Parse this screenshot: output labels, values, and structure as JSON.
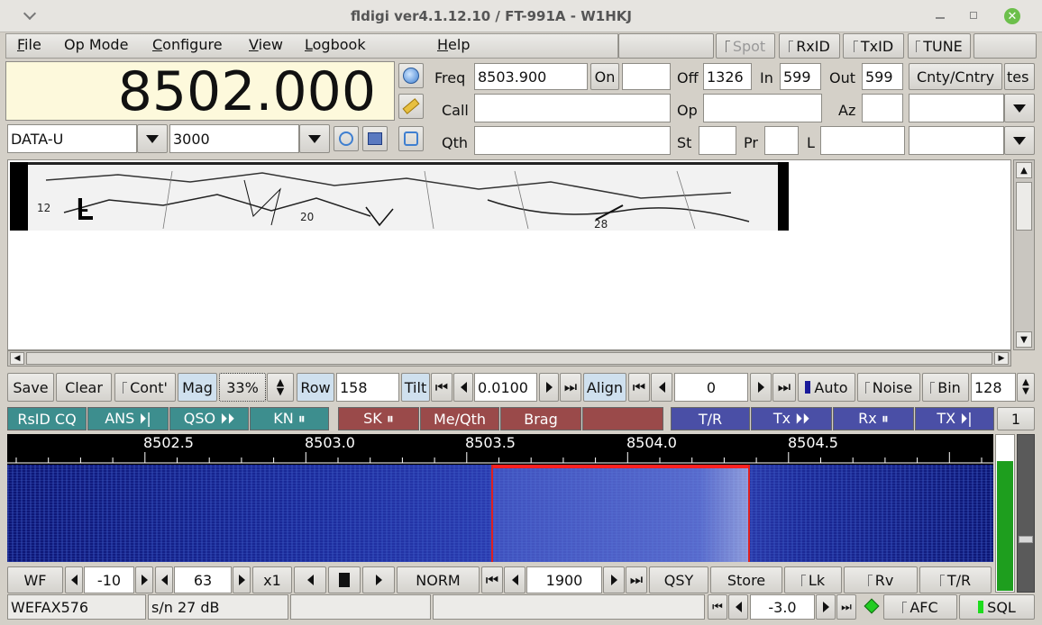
{
  "window": {
    "title": "fldigi ver4.1.12.10 / FT-991A - W1HKJ"
  },
  "menu": {
    "file": "File",
    "op_mode": "Op Mode",
    "configure": "Configure",
    "view": "View",
    "logbook": "Logbook",
    "help": "Help"
  },
  "top_toggles": {
    "spot": "Spot",
    "rxid": "RxID",
    "txid": "TxID",
    "tune": "TUNE"
  },
  "freq_display": {
    "value": "8502.000"
  },
  "rig": {
    "mode": "DATA-U",
    "bandwidth": "3000"
  },
  "log": {
    "freq_label": "Freq",
    "freq_value": "8503.900",
    "on_label": "On",
    "off_label": "Off",
    "off_value": "1326",
    "in_label": "In",
    "in_value": "599",
    "out_label": "Out",
    "out_value": "599",
    "cnty_label": "Cnty/Cntry",
    "tes_label": "tes",
    "call_label": "Call",
    "op_label": "Op",
    "az_label": "Az",
    "qth_label": "Qth",
    "st_label": "St",
    "pr_label": "Pr",
    "l_label": "L"
  },
  "fax_map": {
    "labels": [
      "12",
      "L",
      "20",
      "28"
    ]
  },
  "fax_controls": {
    "save": "Save",
    "clear": "Clear",
    "cont": "Cont'",
    "mag_label": "Mag",
    "mag_value": "33%",
    "row_label": "Row",
    "row_value": "158",
    "tilt_label": "Tilt",
    "tilt_value": "0.0100",
    "align_label": "Align",
    "align_value": "0",
    "auto": "Auto",
    "noise": "Noise",
    "bin": "Bin",
    "bin_value": "128"
  },
  "macros": {
    "b1": "RsID CQ",
    "b2": "ANS ⏵|",
    "b3": "QSO ⏵⏵",
    "b4": "KN ⏸",
    "b5": "SK ⏸",
    "b6": "Me/Qth",
    "b7": "Brag",
    "b8": "",
    "b9": "T/R",
    "b10": "Tx ⏵⏵",
    "b11": "Rx ⏸",
    "b12": "TX ⏵|",
    "bank": "1"
  },
  "scale": {
    "ticks": [
      "8502.5",
      "8503.0",
      "8503.5",
      "8504.0",
      "8504.5"
    ]
  },
  "wf_controls": {
    "wf": "WF",
    "ref": "-10",
    "range": "63",
    "zoom": "x1",
    "norm": "NORM",
    "center": "1900",
    "qsy": "QSY",
    "store": "Store",
    "lk": "Lk",
    "rv": "Rv",
    "tr": "T/R"
  },
  "status": {
    "mode": "WEFAX576",
    "sn": "s/n  27 dB",
    "afc_value": "-3.0",
    "afc": "AFC",
    "sql": "SQL"
  },
  "colors": {
    "freq_bg": "#fdf9dc",
    "waterfall_bg": "#0d1a80",
    "signal_marker": "#ff2020",
    "sql_green": "#1e9e1e"
  }
}
